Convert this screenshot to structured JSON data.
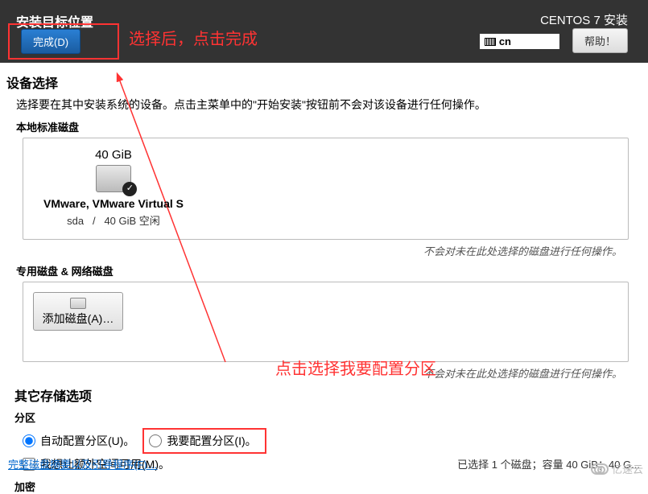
{
  "header": {
    "title": "安装目标位置",
    "done_label": "完成(D)",
    "installer_title": "CENTOS 7 安装",
    "help_label": "帮助！",
    "lang_code": "cn"
  },
  "annotations": {
    "after_select": "选择后，点击完成",
    "choose_partition": "点击选择我要配置分区"
  },
  "device_section": {
    "heading": "设备选择",
    "instruction": "选择要在其中安装系统的设备。点击主菜单中的\"开始安装\"按钮前不会对该设备进行任何操作。",
    "local_heading": "本地标准磁盘",
    "disk": {
      "capacity": "40 GiB",
      "name": "VMware, VMware Virtual S",
      "dev": "sda",
      "sep": "/",
      "free": "40 GiB 空闲"
    },
    "note": "不会对未在此处选择的磁盘进行任何操作。",
    "special_heading": "专用磁盘 & 网络磁盘",
    "add_disk_label": "添加磁盘(A)…"
  },
  "storage_options": {
    "heading": "其它存储选项",
    "partition_label": "分区",
    "auto_label": "自动配置分区(U)。",
    "manual_label": "我要配置分区(I)。",
    "extra_space_label": "我想让额外空间可用(M)。",
    "encrypt_label": "加密"
  },
  "footer": {
    "summary_link": "完整磁盘摘要以及引导程序(F)…",
    "status": "已选择 1 个磁盘；容量 40 GiB；40 G..."
  },
  "watermark": "亿速云"
}
